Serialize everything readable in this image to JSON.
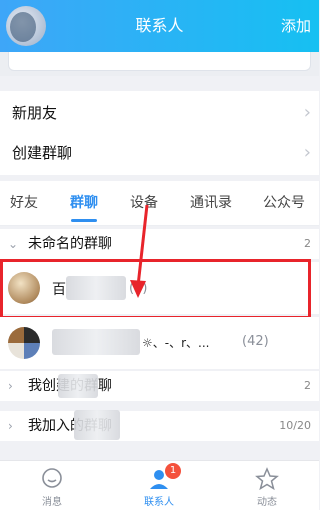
{
  "header": {
    "title": "联系人",
    "add_label": "添加"
  },
  "menu": {
    "new_friends": "新朋友",
    "create_group": "创建群聊"
  },
  "tabs": [
    {
      "label": "好友"
    },
    {
      "label": "群聊"
    },
    {
      "label": "设备"
    },
    {
      "label": "通讯录"
    },
    {
      "label": "公众号"
    }
  ],
  "sections": {
    "unnamed": {
      "label": "未命名的群聊",
      "count": "2"
    },
    "my_created": {
      "label": "我创建的群聊",
      "count": "2"
    },
    "joined": {
      "label": "我加入的群聊",
      "count": "10/20"
    }
  },
  "groups": [
    {
      "name_prefix": "百",
      "count": "(3)"
    },
    {
      "name_suffix": "☼、-、r、...",
      "count": "(42)"
    }
  ],
  "bottom_nav": {
    "messages": "消息",
    "contacts": "联系人",
    "contacts_badge": "1",
    "activity": "动态"
  }
}
